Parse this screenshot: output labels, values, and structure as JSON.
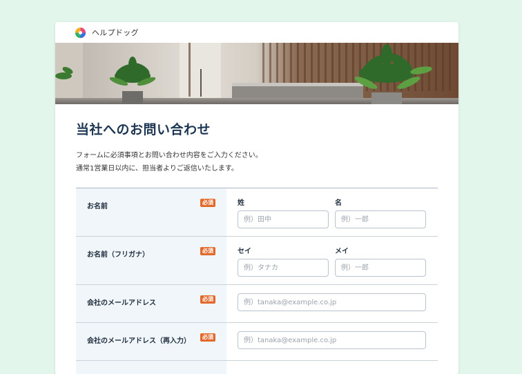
{
  "brand": {
    "name": "ヘルプドッグ"
  },
  "page": {
    "title": "当社へのお問い合わせ",
    "intro_line1": "フォームに必須事項とお問い合わせ内容をご入力ください。",
    "intro_line2": "通常1営業日以内に、担当者よりご返信いたします。"
  },
  "form": {
    "required_badge": "必須",
    "name": {
      "label": "お名前",
      "last_label": "姓",
      "last_placeholder": "例）田中",
      "first_label": "名",
      "first_placeholder": "例）一郎"
    },
    "kana": {
      "label": "お名前（フリガナ）",
      "last_label": "セイ",
      "last_placeholder": "例）タナカ",
      "first_label": "メイ",
      "first_placeholder": "例）一郎"
    },
    "email": {
      "label": "会社のメールアドレス",
      "placeholder": "例）tanaka@example.co.jp"
    },
    "email_confirm": {
      "label": "会社のメールアドレス（再入力）",
      "placeholder": "例）tanaka@example.co.jp"
    }
  },
  "colors": {
    "background": "#e3f6ec",
    "title": "#1c3552",
    "required_badge": "#e2692c",
    "label_cell": "#f0f6fa"
  },
  "icons": {
    "logo": "pinwheel-logo-icon"
  }
}
